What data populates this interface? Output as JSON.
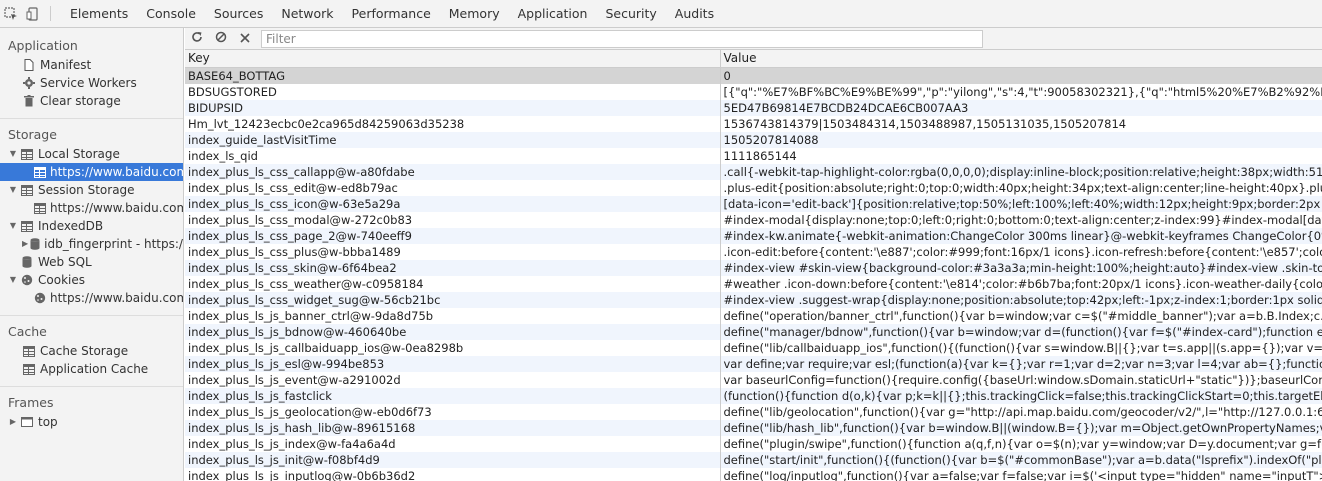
{
  "toolbar_tabs": [
    "Elements",
    "Console",
    "Sources",
    "Network",
    "Performance",
    "Memory",
    "Application",
    "Security",
    "Audits"
  ],
  "sidebar": {
    "application_title": "Application",
    "application_items": [
      "Manifest",
      "Service Workers",
      "Clear storage"
    ],
    "storage_title": "Storage",
    "local_storage": "Local Storage",
    "local_storage_origin": "https://www.baidu.com",
    "session_storage": "Session Storage",
    "session_storage_origin": "https://www.baidu.com",
    "indexeddb": "IndexedDB",
    "indexeddb_item": "idb_fingerprint - https://www.baidu.com",
    "websql": "Web SQL",
    "cookies": "Cookies",
    "cookies_origin": "https://www.baidu.com",
    "cache_title": "Cache",
    "cache_items": [
      "Cache Storage",
      "Application Cache"
    ],
    "frames_title": "Frames",
    "frames_top": "top"
  },
  "filter": {
    "placeholder": "Filter"
  },
  "table": {
    "headers": [
      "Key",
      "Value"
    ],
    "rows": [
      [
        "BASE64_BOTTAG",
        "0"
      ],
      [
        "BDSUGSTORED",
        "[{\"q\":\"%E7%BF%BC%E9%BE%99\",\"p\":\"yilong\",\"s\":4,\"t\":90058302321},{\"q\":\"html5%20%E7%B2%92%E5%AD%90%E7%89%B9%E6%95%88\""
      ],
      [
        "BIDUPSID",
        "5ED47B69814E7BCDB24DCAE6CB007AA3"
      ],
      [
        "Hm_lvt_12423ecbc0e2ca965d84259063d35238",
        "1536743814379|1503484314,1503488987,1505131035,1505207814"
      ],
      [
        "index_guide_lastVisitTime",
        "1505207814088"
      ],
      [
        "index_ls_qid",
        "1111865144"
      ],
      [
        "index_plus_ls_css_callapp@w-a80fdabe",
        ".call{-webkit-tap-highlight-color:rgba(0,0,0,0);display:inline-block;position:relative;height:38px;width:51px;top:0;ba"
      ],
      [
        "index_plus_ls_css_edit@w-ed8b79ac",
        ".plus-edit{position:absolute;right:0;top:0;width:40px;height:34px;text-align:center;line-height:40px}.plus .edit-back{"
      ],
      [
        "index_plus_ls_css_icon@w-63e5a29a",
        "[data-icon='edit-back']{position:relative;top:50%;left:100%;left:40%;width:12px;height:9px;border:2px solid #ccc;"
      ],
      [
        "index_plus_ls_css_modal@w-272c0b83",
        "#index-modal{display:none;top:0;left:0;right:0;bottom:0;text-align:center;z-index:99}#index-modal[data-show='1']"
      ],
      [
        "index_plus_ls_css_page_2@w-740eeff9",
        "#index-kw.animate{-webkit-animation:ChangeColor 300ms linear}@-webkit-keyframes ChangeColor{0%{backgrou"
      ],
      [
        "index_plus_ls_css_plus@w-bbba1489",
        ".icon-edit:before{content:'\\e887';color:#999;font:16px/1 icons}.icon-refresh:before{content:'\\e857';color:#b6b7ba;fo"
      ],
      [
        "index_plus_ls_css_skin@w-6f64bea2",
        "#index-view #skin-view{background-color:#3a3a3a;min-height:100%;height:auto}#index-view .skin-top-wrap{widt"
      ],
      [
        "index_plus_ls_css_weather@w-c0958184",
        "#weather .icon-down:before{content:'\\e814';color:#b6b7ba;font:20px/1 icons}.icon-weather-daily{color:#fff;font-si"
      ],
      [
        "index_plus_ls_css_widget_sug@w-56cb21bc",
        "#index-view .suggest-wrap{display:none;position:absolute;top:42px;left:-1px;z-index:1;border:1px solid #d9dde2;b"
      ],
      [
        "index_plus_ls_js_banner_ctrl@w-9da8d75b",
        "define(\"operation/banner_ctrl\",function(){var b=window;var c=$(\"#middle_banner\");var a=b.B.Index;c.on(\"click\",\".b"
      ],
      [
        "index_plus_ls_js_bdnow@w-460640be",
        "define(\"manager/bdnow\",function(){var b=window;var d=(function(){var f=$(\"#index-card\");function e(g){this.$top"
      ],
      [
        "index_plus_ls_js_callbaiduapp_ios@w-0ea8298b",
        "define(\"lib/callbaiduapp_ios\",function(){(function(){var s=window.B||{};var t=s.app||(s.app={});var v=navigator.userA"
      ],
      [
        "index_plus_ls_js_esl@w-994be853",
        "var define;var require;var esl;(function(a){var k={};var r=1;var d=2;var n=3;var l=4;var ab={};function F(af){if(!g(af,l))"
      ],
      [
        "index_plus_ls_js_event@w-a291002d",
        "var baseurlConfig=function(){require.config({baseUrl:window.sDomain.staticUrl+\"static\"})};baseurlConfig();window"
      ],
      [
        "index_plus_ls_js_fastclick",
        "(function(){function d(o,k){var p;k=k||{};this.trackingClick=false;this.trackingClickStart=0;this.targetElement=null;thi"
      ],
      [
        "index_plus_ls_js_geolocation@w-eb0d6f73",
        "define(\"lib/geolocation\",function(){var g=\"http://api.map.baidu.com/geocoder/v2/\",l=\"http://127.0.0.1:6259/geolo"
      ],
      [
        "index_plus_ls_js_hash_lib@w-89615168",
        "define(\"lib/hash_lib\",function(){var b=window.B||(window.B={});var m=Object.getOwnPropertyNames;var f=b.hash"
      ],
      [
        "index_plus_ls_js_index@w-fa4a6a4d",
        "define(\"plugin/swipe\",function(){function a(q,f,n){var o=$(n);var y=window;var D=y.document;var g=function(){var"
      ],
      [
        "index_plus_ls_js_init@w-f08bf4d9",
        "define(\"start/init\",function(){(function(){var b=$(\"#commonBase\");var a=b.data(\"lsprefix\").indexOf(\"plus\")!==-1;new"
      ],
      [
        "index_plus_ls_js_inputlog@w-0b6b36d2",
        "define(\"log/inputlog\",function(){var a=false;var f=false;var i=$('<input type=\"hidden\" name=\"inputT\">');var e=$("
      ]
    ]
  }
}
